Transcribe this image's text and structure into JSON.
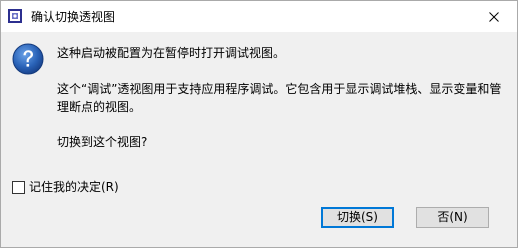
{
  "window": {
    "title": "确认切换透视图",
    "icon": "eclipse-window-icon"
  },
  "message": {
    "icon": "question-icon",
    "line1": "这种启动被配置为在暂停时打开调试视图。",
    "line2": "这个“调试”透视图用于支持应用程序调试。它包含用于显示调试堆栈、显示变量和管\n理断点的视图。",
    "line3": "切换到这个视图?"
  },
  "remember": {
    "label": "记住我的决定(R)",
    "checked": false
  },
  "buttons": {
    "yes_label": "切换(S)",
    "no_label": "否(N)"
  },
  "colors": {
    "dialog_bg": "#f0f0f0",
    "titlebar_bg": "#ffffff",
    "default_button_border": "#0078d7",
    "question_icon_blue": "#1f5fb4"
  }
}
